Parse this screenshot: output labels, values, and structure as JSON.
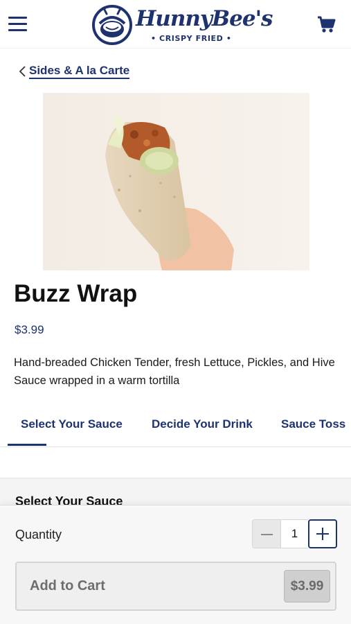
{
  "header": {
    "logo_text": "HunnyBee's",
    "logo_subtext": "• CRISPY FRIED •",
    "menu_icon": "hamburger-menu-icon",
    "cart_icon": "shopping-cart-icon"
  },
  "breadcrumb": {
    "icon": "chevron-left-icon",
    "label": "Sides & A la Carte"
  },
  "product": {
    "image_alt": "hand holding a wrap",
    "title": "Buzz Wrap",
    "price": "$3.99",
    "description": "Hand-breaded Chicken Tender, fresh Lettuce, Pickles, and Hive Sauce wrapped in a warm tortilla"
  },
  "tabs": [
    {
      "label": "Select Your Sauce",
      "active": true
    },
    {
      "label": "Decide Your Drink",
      "active": false
    },
    {
      "label": "Sauce Toss",
      "active": false
    }
  ],
  "section": {
    "title": "Select Your Sauce"
  },
  "order": {
    "quantity_label": "Quantity",
    "quantity_value": "1",
    "add_to_cart_label": "Add to Cart",
    "total_price": "$3.99"
  },
  "colors": {
    "brand_navy": "#1e3270",
    "disabled_gray": "#cfcfcf"
  }
}
